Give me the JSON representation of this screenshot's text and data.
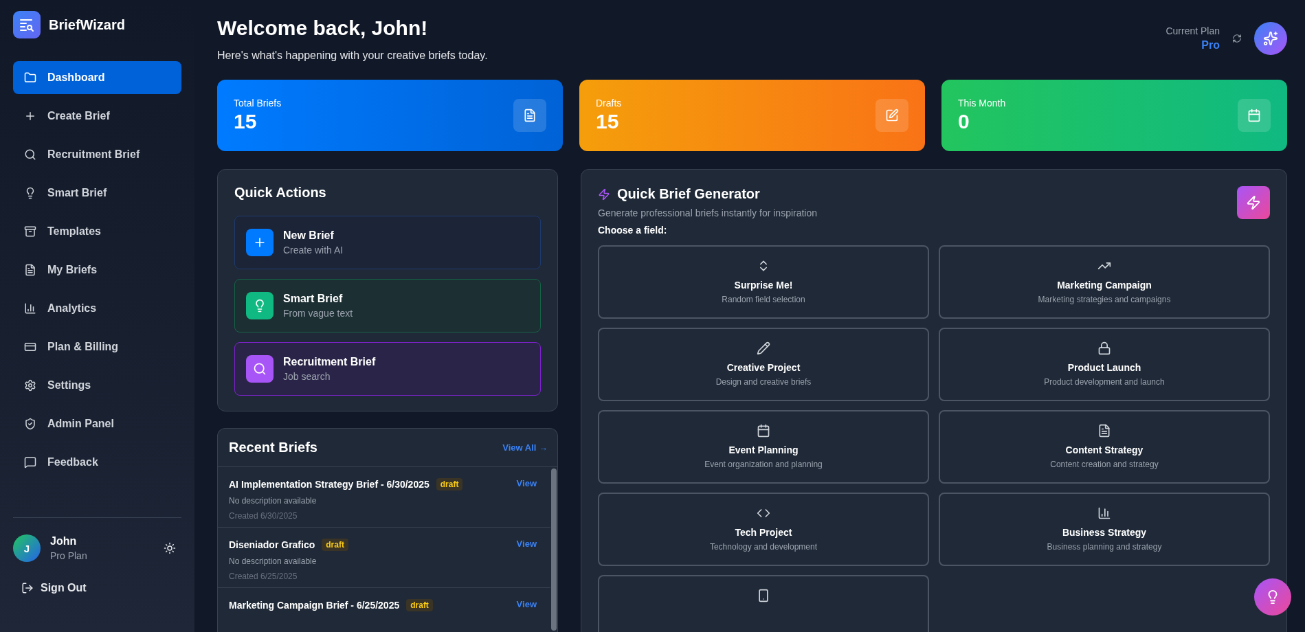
{
  "brand": "BriefWizard",
  "sidebar": {
    "items": [
      {
        "label": "Dashboard",
        "selected": true
      },
      {
        "label": "Create Brief",
        "selected": false
      },
      {
        "label": "Recruitment Brief",
        "selected": false
      },
      {
        "label": "Smart Brief",
        "selected": false
      },
      {
        "label": "Templates",
        "selected": false
      },
      {
        "label": "My Briefs",
        "selected": false
      },
      {
        "label": "Analytics",
        "selected": false
      },
      {
        "label": "Plan & Billing",
        "selected": false
      },
      {
        "label": "Settings",
        "selected": false
      },
      {
        "label": "Admin Panel",
        "selected": false
      },
      {
        "label": "Feedback",
        "selected": false
      }
    ],
    "user": {
      "initial": "J",
      "name": "John",
      "plan": "Pro Plan"
    },
    "sign_out": "Sign Out"
  },
  "header": {
    "title": "Welcome back, John!",
    "subtitle": "Here's what's happening with your creative briefs today.",
    "plan_label": "Current Plan",
    "plan": "Pro"
  },
  "stats": [
    {
      "label": "Total Briefs",
      "value": "15",
      "kind": "total"
    },
    {
      "label": "Drafts",
      "value": "15",
      "kind": "drafts"
    },
    {
      "label": "This Month",
      "value": "0",
      "kind": "month"
    }
  ],
  "quick_actions": {
    "title": "Quick Actions",
    "items": [
      {
        "title": "New Brief",
        "subtitle": "Create with AI",
        "kind": "new"
      },
      {
        "title": "Smart Brief",
        "subtitle": "From vague text",
        "kind": "smart"
      },
      {
        "title": "Recruitment Brief",
        "subtitle": "Job search",
        "kind": "recruit"
      }
    ]
  },
  "recent_briefs": {
    "title": "Recent Briefs",
    "view_all": "View All →",
    "rows": [
      {
        "title": "AI Implementation Strategy Brief - 6/30/2025",
        "status": "draft",
        "description": "No description available",
        "created": "Created 6/30/2025",
        "action": "View"
      },
      {
        "title": "Diseniador Grafico",
        "status": "draft",
        "description": "No description available",
        "created": "Created 6/25/2025",
        "action": "View"
      },
      {
        "title": "Marketing Campaign Brief - 6/25/2025",
        "status": "draft",
        "action": "View"
      }
    ]
  },
  "generator": {
    "title": "Quick Brief Generator",
    "subtitle": "Generate professional briefs instantly for inspiration",
    "prompt": "Choose a field:",
    "fields": [
      {
        "title": "Surprise Me!",
        "description": "Random field selection"
      },
      {
        "title": "Marketing Campaign",
        "description": "Marketing strategies and campaigns"
      },
      {
        "title": "Creative Project",
        "description": "Design and creative briefs"
      },
      {
        "title": "Product Launch",
        "description": "Product development and launch"
      },
      {
        "title": "Event Planning",
        "description": "Event organization and planning"
      },
      {
        "title": "Content Strategy",
        "description": "Content creation and strategy"
      },
      {
        "title": "Tech Project",
        "description": "Technology and development"
      },
      {
        "title": "Business Strategy",
        "description": "Business planning and strategy"
      },
      {
        "kind": "icon_only"
      }
    ]
  }
}
